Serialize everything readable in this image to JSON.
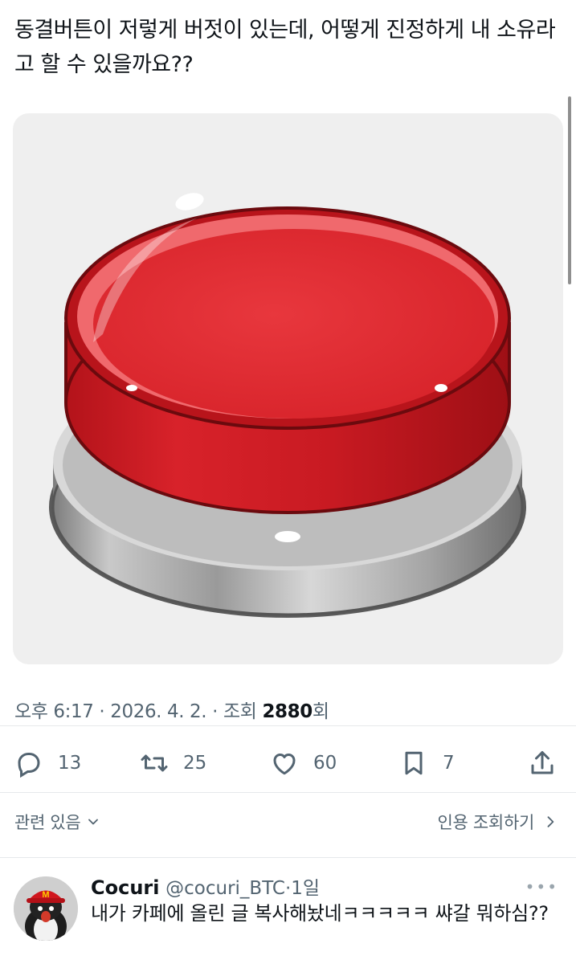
{
  "tweet": {
    "text": "동결버튼이 저렇게 버젓이 있는데, 어떻게 진정하게 내 소유라고 할 수 있을까요??",
    "meta": {
      "time": "오후 6:17",
      "date": "2026. 4. 2.",
      "views_label": "조회",
      "views_count": "2880",
      "views_suffix": "회",
      "separator": "·"
    },
    "actions": {
      "replies": "13",
      "retweets": "25",
      "likes": "60",
      "bookmarks": "7"
    },
    "related_label": "관련 있음",
    "quotes_label": "인용 조회하기"
  },
  "reply": {
    "name": "Cocuri",
    "handle": "@cocuri_BTC",
    "separator": "·",
    "age": "1일",
    "text": "내가 카페에 올린 글 복사해놨네ㅋㅋㅋㅋㅋ 쌰갈 뭐하심??"
  },
  "colors": {
    "text": "#0f1419",
    "secondary": "#536471",
    "button_red": "#e0262d",
    "media_bg": "#efefef"
  },
  "icons": [
    "reply-icon",
    "retweet-icon",
    "like-icon",
    "bookmark-icon",
    "share-icon",
    "chevron-down-icon",
    "chevron-right-icon",
    "more-icon"
  ]
}
